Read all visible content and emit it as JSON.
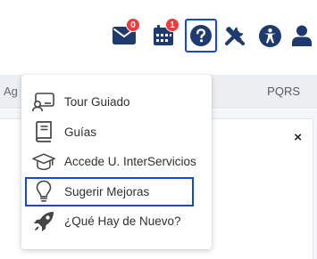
{
  "toolbar": {
    "mail_badge": "0",
    "calendar_badge": "1",
    "icons": [
      "mail-icon",
      "calendar-icon",
      "help-icon",
      "tools-icon",
      "accessibility-icon",
      "user-icon"
    ],
    "accent_color": "#1f3a6e",
    "badge_color": "#ef3b3b",
    "focus_color": "#1747d6"
  },
  "nav": {
    "left_label": "Ag",
    "right_label": "PQRS"
  },
  "panel": {
    "close_label": "×"
  },
  "help_menu": {
    "items": [
      {
        "label": "Tour Guiado",
        "icon": "guided-tour-icon"
      },
      {
        "label": "Guías",
        "icon": "book-icon"
      },
      {
        "label": "Accede U. InterServicios",
        "icon": "graduation-cap-icon"
      },
      {
        "label": "Sugerir Mejoras",
        "icon": "lightbulb-icon",
        "selected": true
      },
      {
        "label": "¿Qué Hay de Nuevo?",
        "icon": "rocket-icon"
      }
    ]
  }
}
